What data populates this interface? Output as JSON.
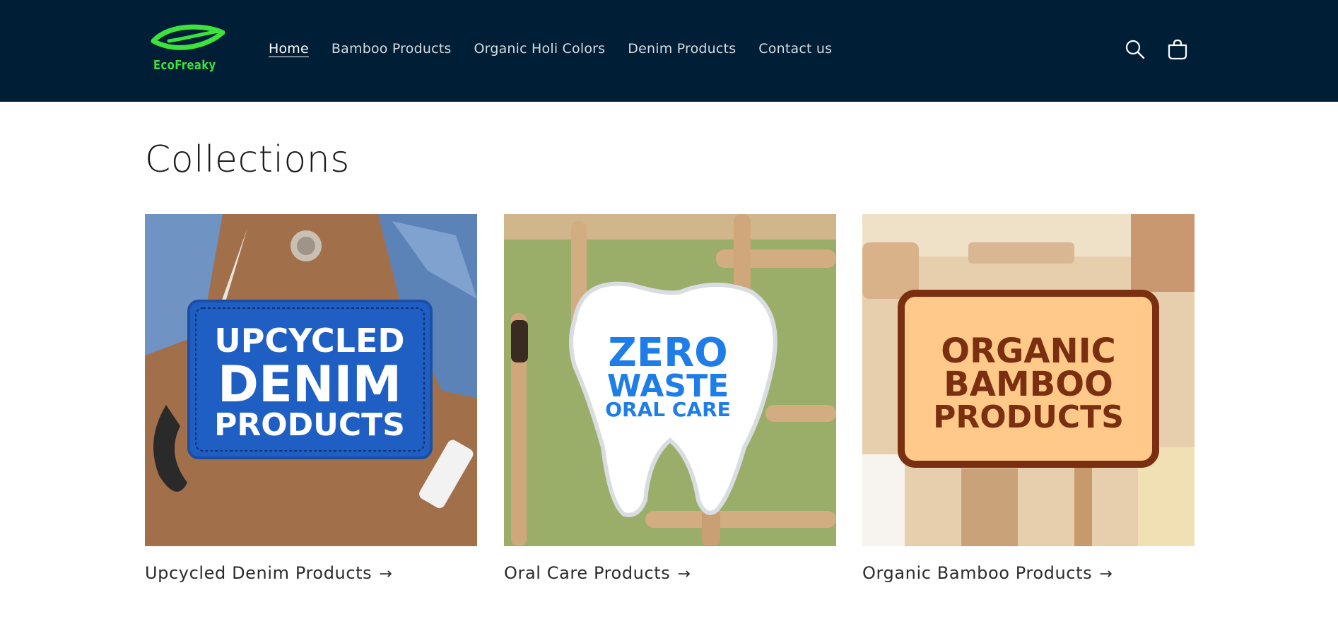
{
  "header": {
    "logo_text": "EcoFreaky",
    "nav": [
      {
        "label": "Home",
        "active": true
      },
      {
        "label": "Bamboo Products",
        "active": false
      },
      {
        "label": "Organic Holi Colors",
        "active": false
      },
      {
        "label": "Denim Products",
        "active": false
      },
      {
        "label": "Contact us",
        "active": false
      }
    ],
    "icons": [
      "search-icon",
      "cart-icon"
    ]
  },
  "main": {
    "title": "Collections",
    "collections": [
      {
        "label": "Upcycled Denim Products",
        "arrow": "→",
        "image_text": [
          "UPCYCLED",
          "DENIM",
          "PRODUCTS"
        ]
      },
      {
        "label": "Oral Care Products",
        "arrow": "→",
        "image_text": [
          "ZERO",
          "WASTE",
          "ORAL CARE"
        ]
      },
      {
        "label": "Organic Bamboo Products",
        "arrow": "→",
        "image_text": [
          "ORGANIC",
          "BAMBOO",
          "PRODUCTS"
        ]
      }
    ]
  },
  "colors": {
    "header_bg": "#001e36",
    "logo_green": "#3de23d",
    "denim_blue": "#1f5fc4",
    "oral_blue": "#1f7de8",
    "bamboo_brown": "#7a2f10"
  }
}
